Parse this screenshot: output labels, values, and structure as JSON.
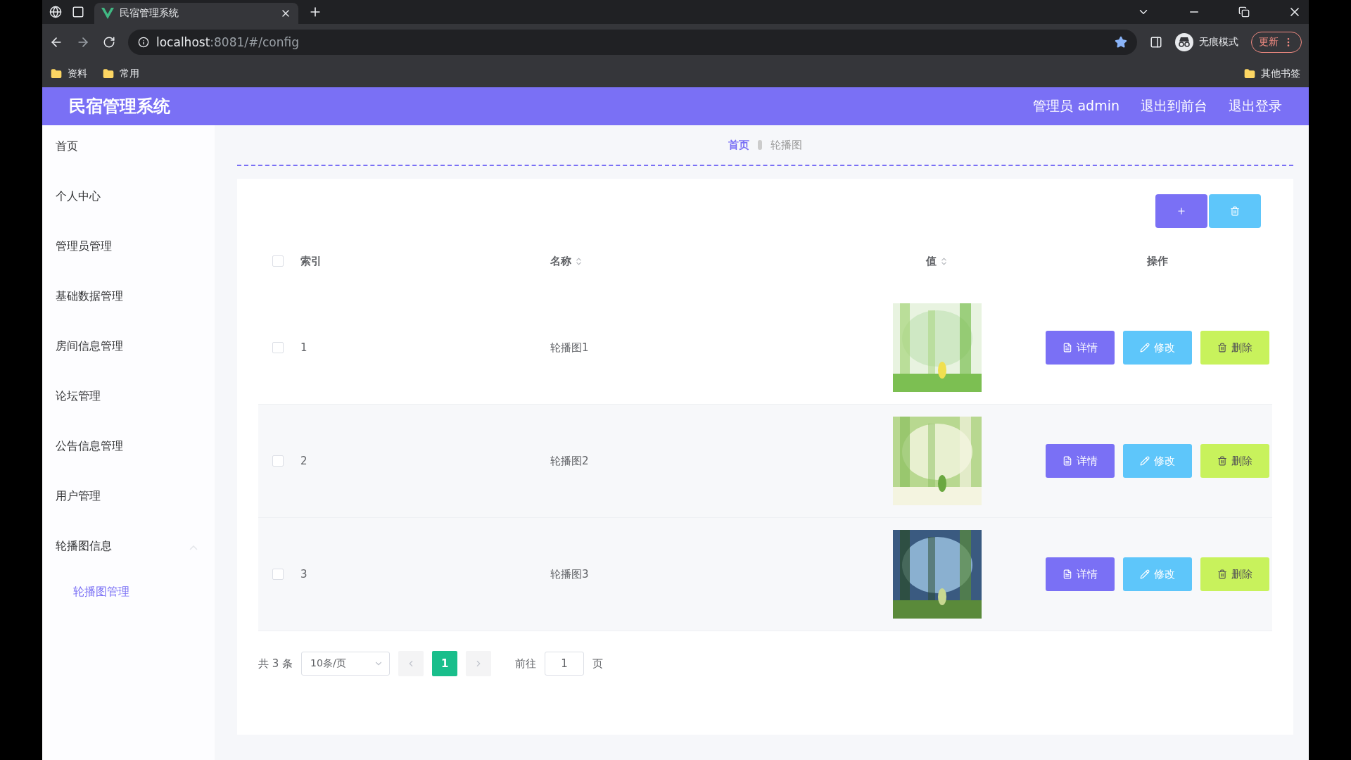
{
  "browser": {
    "tabs": [
      {
        "title": "民宿管理系统",
        "selected": true
      }
    ],
    "address": {
      "host": "localhost",
      "path": ":8081/#/config"
    },
    "bookmarks": [
      "资料",
      "常用"
    ],
    "other_bookmarks": "其他书签",
    "incognito": "无痕模式",
    "update_button": "更新"
  },
  "app": {
    "title": "民宿管理系统",
    "header_links": [
      "管理员 admin",
      "退出到前台",
      "退出登录"
    ],
    "sidebar": {
      "items": [
        {
          "label": "首页",
          "selected": false
        },
        {
          "label": "个人中心",
          "selected": false
        },
        {
          "label": "管理员管理",
          "selected": false
        },
        {
          "label": "基础数据管理",
          "selected": false
        },
        {
          "label": "房间信息管理",
          "selected": false
        },
        {
          "label": "论坛管理",
          "selected": false
        },
        {
          "label": "公告信息管理",
          "selected": false
        },
        {
          "label": "用户管理",
          "selected": false
        },
        {
          "label": "轮播图信息",
          "selected": false,
          "expanded": true,
          "children": [
            {
              "label": "轮播图管理",
              "selected": true
            }
          ]
        }
      ]
    },
    "breadcrumb": [
      "首页",
      "轮播图"
    ],
    "table": {
      "all_checked": false,
      "columns": [
        {
          "label": "索引",
          "sortable": false
        },
        {
          "label": "名称",
          "sortable": true
        },
        {
          "label": "值",
          "sortable": true
        },
        {
          "label": "操作",
          "sortable": false
        }
      ],
      "rows": [
        {
          "checked": false,
          "index": "1",
          "name": "轮播图1",
          "value": {
            "kind": "picture"
          },
          "actions": [
            {
              "kind": "detail",
              "label": "详情"
            },
            {
              "kind": "edit",
              "label": "修改"
            },
            {
              "kind": "delete",
              "label": "删除"
            }
          ]
        },
        {
          "checked": false,
          "index": "2",
          "name": "轮播图2",
          "value": {
            "kind": "picture"
          },
          "actions": [
            {
              "kind": "detail",
              "label": "详情"
            },
            {
              "kind": "edit",
              "label": "修改"
            },
            {
              "kind": "delete",
              "label": "删除"
            }
          ]
        },
        {
          "checked": false,
          "index": "3",
          "name": "轮播图3",
          "value": {
            "kind": "picture"
          },
          "actions": [
            {
              "kind": "detail",
              "label": "详情"
            },
            {
              "kind": "edit",
              "label": "修改"
            },
            {
              "kind": "delete",
              "label": "删除"
            }
          ]
        }
      ]
    },
    "pagination": {
      "total": "共 3 条",
      "page_size": "10条/页",
      "pages": [
        {
          "label": "1",
          "selected": true
        }
      ],
      "goto_label": "前往",
      "goto_value": "1",
      "page_unit": "页"
    }
  }
}
